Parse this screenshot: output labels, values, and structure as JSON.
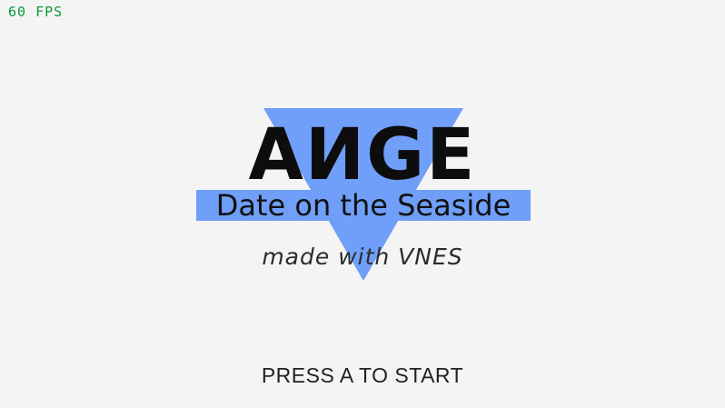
{
  "hud": {
    "fps_label": "60 FPS"
  },
  "title_screen": {
    "logo_text": "АИGE",
    "subtitle": "Date on the Seaside",
    "credit": "made with VNES",
    "start_prompt": "PRESS A TO START"
  },
  "colors": {
    "background": "#f4f4f4",
    "accent_blue": "#6f9ff8",
    "fps_green": "#0a9a3a",
    "text_dark": "#111111"
  }
}
